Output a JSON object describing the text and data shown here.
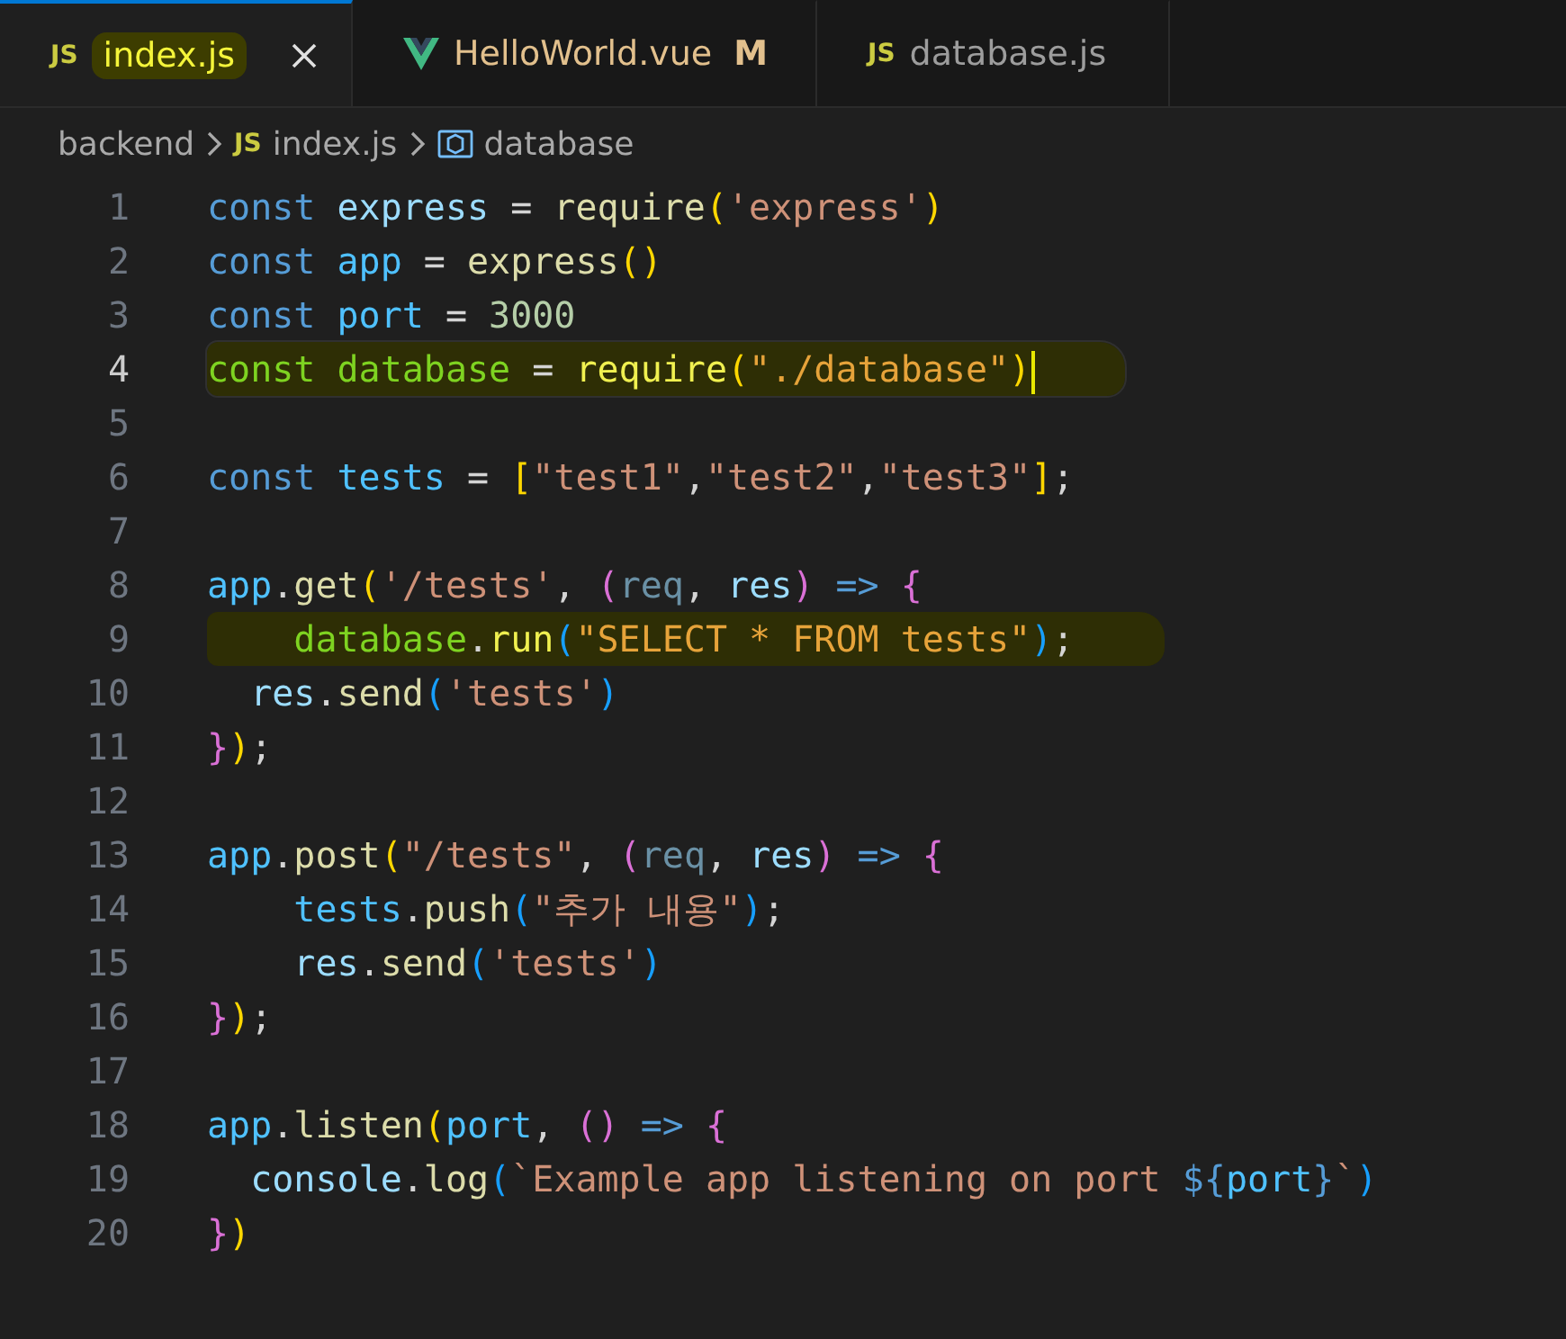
{
  "tabs": [
    {
      "kind": "js",
      "icon_text": "JS",
      "label": "index.js",
      "selected": true,
      "highlighted": true,
      "modified": false,
      "closable": true
    },
    {
      "kind": "vue",
      "label": "HelloWorld.vue",
      "selected": false,
      "highlighted": false,
      "modified": true,
      "badge": "M",
      "closable": false
    },
    {
      "kind": "js",
      "icon_text": "JS",
      "label": "database.js",
      "selected": false,
      "highlighted": false,
      "modified": false,
      "closable": false
    }
  ],
  "breadcrumb": [
    {
      "kind": "folder",
      "label": "backend"
    },
    {
      "kind": "file",
      "icon_text": "JS",
      "label": "index.js"
    },
    {
      "kind": "symbol",
      "label": "database"
    }
  ],
  "lines": [
    {
      "number": "1",
      "active": false,
      "highlighted": false,
      "tokens": [
        {
          "kind": "kw",
          "text": "const "
        },
        {
          "kind": "var",
          "text": "express"
        },
        {
          "kind": "op",
          "text": " = "
        },
        {
          "kind": "fn",
          "text": "require"
        },
        {
          "kind": "b1",
          "text": "("
        },
        {
          "kind": "str",
          "text": "'express'"
        },
        {
          "kind": "b1",
          "text": ")"
        }
      ]
    },
    {
      "number": "2",
      "active": false,
      "highlighted": false,
      "tokens": [
        {
          "kind": "kw",
          "text": "const "
        },
        {
          "kind": "cst",
          "text": "app"
        },
        {
          "kind": "op",
          "text": " = "
        },
        {
          "kind": "fn",
          "text": "express"
        },
        {
          "kind": "b1",
          "text": "()"
        }
      ]
    },
    {
      "number": "3",
      "active": false,
      "highlighted": false,
      "tokens": [
        {
          "kind": "kw",
          "text": "const "
        },
        {
          "kind": "cst",
          "text": "port"
        },
        {
          "kind": "op",
          "text": " = "
        },
        {
          "kind": "num",
          "text": "3000"
        }
      ]
    },
    {
      "number": "4",
      "active": true,
      "highlighted": true,
      "tokens": [
        {
          "kind": "kw",
          "text": "const "
        },
        {
          "kind": "cst",
          "text": "database"
        },
        {
          "kind": "op",
          "text": " = "
        },
        {
          "kind": "fn",
          "text": "require"
        },
        {
          "kind": "b1",
          "text": "("
        },
        {
          "kind": "str",
          "text": "\"./database\""
        },
        {
          "kind": "b1",
          "text": ")"
        }
      ]
    },
    {
      "number": "5",
      "active": false,
      "highlighted": false
    },
    {
      "number": "6",
      "active": false,
      "highlighted": false,
      "tokens": [
        {
          "kind": "kw",
          "text": "const "
        },
        {
          "kind": "cst",
          "text": "tests"
        },
        {
          "kind": "op",
          "text": " = "
        },
        {
          "kind": "b1",
          "text": "["
        },
        {
          "kind": "str",
          "text": "\"test1\""
        },
        {
          "kind": "op",
          "text": ","
        },
        {
          "kind": "str",
          "text": "\"test2\""
        },
        {
          "kind": "op",
          "text": ","
        },
        {
          "kind": "str",
          "text": "\"test3\""
        },
        {
          "kind": "b1",
          "text": "]"
        },
        {
          "kind": "op",
          "text": ";"
        }
      ]
    },
    {
      "number": "7",
      "active": false,
      "highlighted": false
    },
    {
      "number": "8",
      "active": false,
      "highlighted": false,
      "tokens": [
        {
          "kind": "cst",
          "text": "app"
        },
        {
          "kind": "op",
          "text": "."
        },
        {
          "kind": "fn",
          "text": "get"
        },
        {
          "kind": "b1",
          "text": "("
        },
        {
          "kind": "str",
          "text": "'/tests'"
        },
        {
          "kind": "op",
          "text": ", "
        },
        {
          "kind": "b2",
          "text": "("
        },
        {
          "kind": "dim",
          "text": "req"
        },
        {
          "kind": "op",
          "text": ", "
        },
        {
          "kind": "var",
          "text": "res"
        },
        {
          "kind": "b2",
          "text": ")"
        },
        {
          "kind": "kw",
          "text": " => "
        },
        {
          "kind": "b2",
          "text": "{"
        }
      ]
    },
    {
      "number": "9",
      "active": false,
      "highlighted": true,
      "tokens": [
        {
          "kind": "cst",
          "text": "    database"
        },
        {
          "kind": "op",
          "text": "."
        },
        {
          "kind": "fn",
          "text": "run"
        },
        {
          "kind": "b3",
          "text": "("
        },
        {
          "kind": "str",
          "text": "\"SELECT * FROM tests\""
        },
        {
          "kind": "b3",
          "text": ")"
        },
        {
          "kind": "op",
          "text": ";"
        }
      ]
    },
    {
      "number": "10",
      "active": false,
      "highlighted": false,
      "tokens": [
        {
          "kind": "var",
          "text": "  res"
        },
        {
          "kind": "op",
          "text": "."
        },
        {
          "kind": "fn",
          "text": "send"
        },
        {
          "kind": "b3",
          "text": "("
        },
        {
          "kind": "str",
          "text": "'tests'"
        },
        {
          "kind": "b3",
          "text": ")"
        }
      ]
    },
    {
      "number": "11",
      "active": false,
      "highlighted": false,
      "tokens": [
        {
          "kind": "b2",
          "text": "}"
        },
        {
          "kind": "b1",
          "text": ")"
        },
        {
          "kind": "op",
          "text": ";"
        }
      ]
    },
    {
      "number": "12",
      "active": false,
      "highlighted": false
    },
    {
      "number": "13",
      "active": false,
      "highlighted": false,
      "tokens": [
        {
          "kind": "cst",
          "text": "app"
        },
        {
          "kind": "op",
          "text": "."
        },
        {
          "kind": "fn",
          "text": "post"
        },
        {
          "kind": "b1",
          "text": "("
        },
        {
          "kind": "str",
          "text": "\"/tests\""
        },
        {
          "kind": "op",
          "text": ", "
        },
        {
          "kind": "b2",
          "text": "("
        },
        {
          "kind": "dim",
          "text": "req"
        },
        {
          "kind": "op",
          "text": ", "
        },
        {
          "kind": "var",
          "text": "res"
        },
        {
          "kind": "b2",
          "text": ")"
        },
        {
          "kind": "kw",
          "text": " => "
        },
        {
          "kind": "b2",
          "text": "{"
        }
      ]
    },
    {
      "number": "14",
      "active": false,
      "highlighted": false,
      "tokens": [
        {
          "kind": "cst",
          "text": "    tests"
        },
        {
          "kind": "op",
          "text": "."
        },
        {
          "kind": "fn",
          "text": "push"
        },
        {
          "kind": "b3",
          "text": "("
        },
        {
          "kind": "str",
          "text": "\"추가 내용\""
        },
        {
          "kind": "b3",
          "text": ")"
        },
        {
          "kind": "op",
          "text": ";"
        }
      ]
    },
    {
      "number": "15",
      "active": false,
      "highlighted": false,
      "tokens": [
        {
          "kind": "var",
          "text": "    res"
        },
        {
          "kind": "op",
          "text": "."
        },
        {
          "kind": "fn",
          "text": "send"
        },
        {
          "kind": "b3",
          "text": "("
        },
        {
          "kind": "str",
          "text": "'tests'"
        },
        {
          "kind": "b3",
          "text": ")"
        }
      ]
    },
    {
      "number": "16",
      "active": false,
      "highlighted": false,
      "tokens": [
        {
          "kind": "b2",
          "text": "}"
        },
        {
          "kind": "b1",
          "text": ")"
        },
        {
          "kind": "op",
          "text": ";"
        }
      ]
    },
    {
      "number": "17",
      "active": false,
      "highlighted": false
    },
    {
      "number": "18",
      "active": false,
      "highlighted": false,
      "tokens": [
        {
          "kind": "cst",
          "text": "app"
        },
        {
          "kind": "op",
          "text": "."
        },
        {
          "kind": "fn",
          "text": "listen"
        },
        {
          "kind": "b1",
          "text": "("
        },
        {
          "kind": "cst",
          "text": "port"
        },
        {
          "kind": "op",
          "text": ", "
        },
        {
          "kind": "b2",
          "text": "()"
        },
        {
          "kind": "kw",
          "text": " => "
        },
        {
          "kind": "b2",
          "text": "{"
        }
      ]
    },
    {
      "number": "19",
      "active": false,
      "highlighted": false,
      "tokens": [
        {
          "kind": "var",
          "text": "  console"
        },
        {
          "kind": "op",
          "text": "."
        },
        {
          "kind": "fn",
          "text": "log"
        },
        {
          "kind": "b3",
          "text": "("
        },
        {
          "kind": "str",
          "text": "`Example app listening on port "
        },
        {
          "kind": "kw",
          "text": "${"
        },
        {
          "kind": "cst",
          "text": "port"
        },
        {
          "kind": "kw",
          "text": "}"
        },
        {
          "kind": "str",
          "text": "`"
        },
        {
          "kind": "b3",
          "text": ")"
        }
      ]
    },
    {
      "number": "20",
      "active": false,
      "highlighted": false,
      "tokens": [
        {
          "kind": "b2",
          "text": "}"
        },
        {
          "kind": "b1",
          "text": ")"
        }
      ]
    }
  ]
}
